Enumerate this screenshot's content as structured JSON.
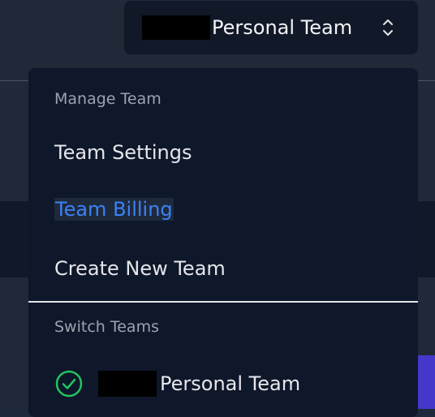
{
  "header": {
    "current_team": "Personal Team"
  },
  "dropdown": {
    "manage_label": "Manage Team",
    "items": [
      {
        "label": "Team Settings"
      },
      {
        "label": "Team Billing"
      },
      {
        "label": "Create New Team"
      }
    ],
    "switch_label": "Switch Teams",
    "teams": [
      {
        "label": "Personal Team",
        "selected": true
      }
    ]
  },
  "colors": {
    "active_item": "#3b82f6",
    "check": "#22c55e"
  },
  "icons": {
    "switcher": "chevron-up-down-icon",
    "selected_team": "check-circle-icon"
  }
}
